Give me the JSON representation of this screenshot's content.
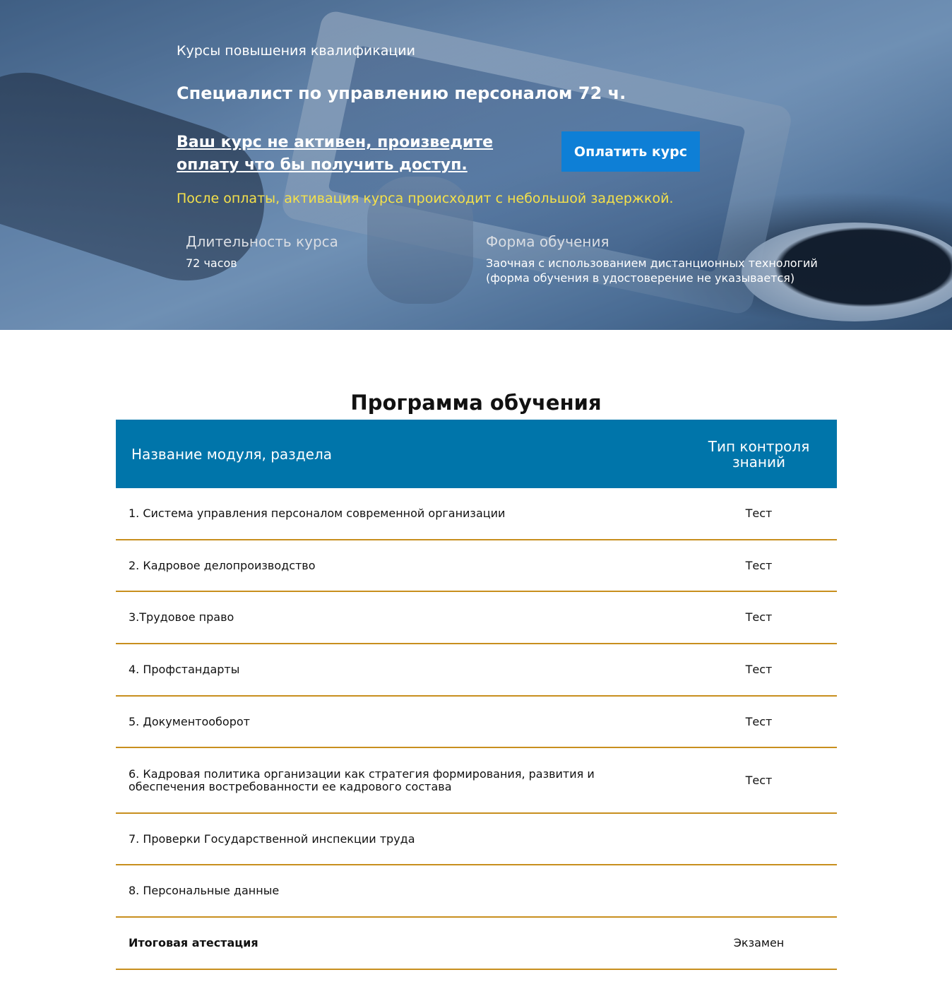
{
  "hero": {
    "subtitle": "Курсы повышения квалификации",
    "title": "Специалист по управлению персоналом 72 ч.",
    "warning": "Ваш курс не активен, произведите оплату что бы получить доступ.",
    "pay_button": "Оплатить курс",
    "note": "После оплаты, активация курса происходит с небольшой задержкой.",
    "duration_label": "Длительность курса",
    "duration_value": "72 часов",
    "form_label": "Форма обучения",
    "form_value": "Заочная с использованием дистанционных технологий (форма обучения в удостоверение не указывается)"
  },
  "program": {
    "title": "Программа обучения",
    "columns": {
      "name": "Название модуля, раздела",
      "type": "Тип контроля знаний"
    },
    "rows": [
      {
        "name": "1. Система управления персоналом современной организации",
        "type": "Тест"
      },
      {
        "name": "2. Кадровое делопроизводство",
        "type": "Тест"
      },
      {
        "name": "3.Трудовое право",
        "type": "Тест"
      },
      {
        "name": "4. Профстандарты",
        "type": "Тест"
      },
      {
        "name": "5. Документооборот",
        "type": "Тест"
      },
      {
        "name": "6. Кадровая политика организации как стратегия формирования, развития и обеспечения востребованности ее кадрового состава",
        "type": "Тест"
      },
      {
        "name": "7. Проверки Государственной инспекции труда",
        "type": ""
      },
      {
        "name": "8. Персональные данные",
        "type": ""
      },
      {
        "name": "Итоговая атестация",
        "type": "Экзамен"
      }
    ]
  },
  "colors": {
    "header_blue": "#0075aa",
    "button_blue": "#0e7fd6",
    "note_yellow": "#f5e14a",
    "row_border": "#c88f1e"
  }
}
